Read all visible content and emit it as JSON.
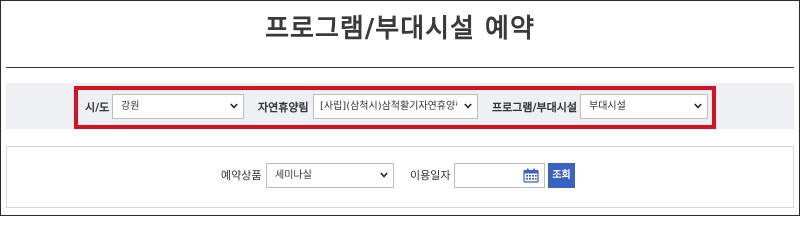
{
  "page": {
    "title": "프로그램/부대시설 예약"
  },
  "filters": {
    "sido_label": "시/도",
    "sido_value": "강원",
    "forest_label": "자연휴양림",
    "forest_value": "[사립](삼척시)삼척활기자연휴양림",
    "facility_label": "프로그램/부대시설",
    "facility_value": "부대시설",
    "highlight_color": "#d8101f"
  },
  "search": {
    "product_label": "예약상품",
    "product_value": "세미나실",
    "date_label": "이용일자",
    "date_value": "",
    "submit_label": "조회",
    "submit_color": "#3a62c2"
  },
  "icons": {
    "dropdown": "chevron-down-icon",
    "calendar": "calendar-icon"
  }
}
